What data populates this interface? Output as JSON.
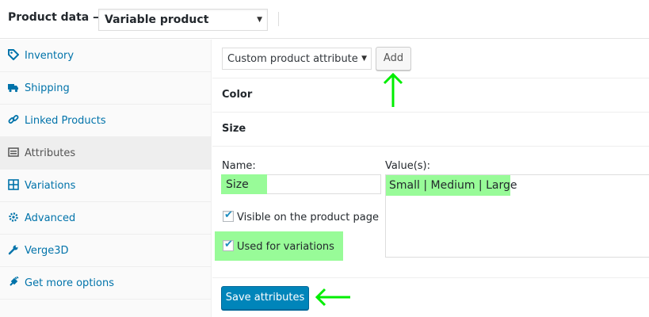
{
  "header": {
    "title": "Product data —",
    "product_type": "Variable product"
  },
  "sidebar": {
    "items": [
      {
        "label": "Inventory",
        "icon": "tag-icon"
      },
      {
        "label": "Shipping",
        "icon": "truck-icon"
      },
      {
        "label": "Linked Products",
        "icon": "link-icon"
      },
      {
        "label": "Attributes",
        "icon": "list-icon",
        "active": true
      },
      {
        "label": "Variations",
        "icon": "grid-icon"
      },
      {
        "label": "Advanced",
        "icon": "gear-icon"
      },
      {
        "label": "Verge3D",
        "icon": "wrench-icon"
      },
      {
        "label": "Get more options",
        "icon": "plugin-icon"
      }
    ]
  },
  "toolbar": {
    "attribute_select": "Custom product attribute",
    "add_label": "Add"
  },
  "attributes": [
    {
      "name": "Color"
    },
    {
      "name": "Size"
    }
  ],
  "form": {
    "name_label": "Name:",
    "name_value": "Size",
    "values_label": "Value(s):",
    "values_value": "Small | Medium | Large",
    "visible_label": "Visible on the product page",
    "visible_checked": true,
    "variations_label": "Used for variations",
    "variations_checked": true
  },
  "save_label": "Save attributes",
  "colors": {
    "accent": "#0073aa",
    "primary_button": "#0085ba",
    "highlight": "#98fb98",
    "annotation_arrow": "#00ee00"
  }
}
